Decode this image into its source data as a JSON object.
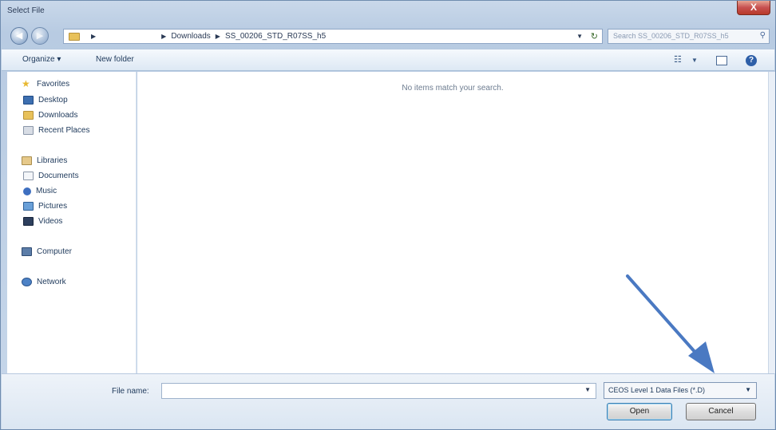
{
  "window": {
    "title": "Select File",
    "close_label": "X"
  },
  "address": {
    "crumbs": [
      "Downloads",
      "SS_00206_STD_R07SS_h5"
    ],
    "search_placeholder": "Search SS_00206_STD_R07SS_h5"
  },
  "toolbar": {
    "organize_label": "Organize ▾",
    "new_folder_label": "New folder",
    "help_label": "?"
  },
  "nav": {
    "favorites": {
      "label": "Favorites",
      "items": [
        "Desktop",
        "Downloads",
        "Recent Places"
      ]
    },
    "libraries": {
      "label": "Libraries",
      "items": [
        "Documents",
        "Music",
        "Pictures",
        "Videos"
      ]
    },
    "computer_label": "Computer",
    "network_label": "Network"
  },
  "content": {
    "empty_message": "No items match your search."
  },
  "footer": {
    "file_name_label": "File name:",
    "file_name_value": "",
    "file_type_selected": "CEOS Level 1 Data Files (*.D)",
    "open_label": "Open",
    "cancel_label": "Cancel"
  },
  "colors": {
    "annotation_arrow": "#4a79c2",
    "title_bar": "#c9d8ea",
    "close_button": "#c75050"
  }
}
